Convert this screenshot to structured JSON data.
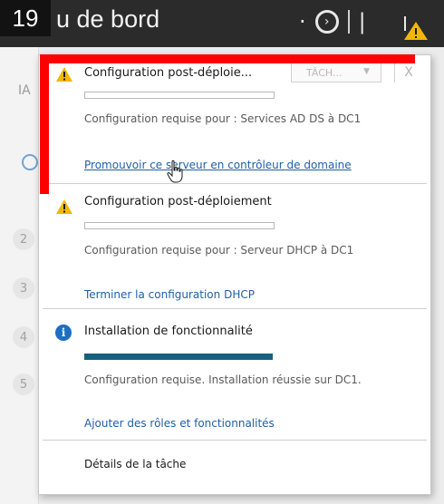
{
  "step_badge": "19",
  "header": {
    "title_fragment": "u de bord"
  },
  "panel": {
    "notifications": [
      {
        "icon": "warning-icon",
        "title": "Configuration post-déploie...",
        "progress": 0,
        "task_dropdown": "TÂCH...",
        "close": "X",
        "description": "Configuration requise pour : Services AD DS à DC1",
        "link": "Promouvoir ce serveur en contrôleur de domaine"
      },
      {
        "icon": "warning-icon",
        "title": "Configuration post-déploiement",
        "progress": 0,
        "description": "Configuration requise pour : Serveur DHCP à DC1",
        "link": "Terminer la configuration DHCP"
      },
      {
        "icon": "info-icon",
        "title": "Installation de fonctionnalité",
        "progress": 1,
        "description": "Configuration requise. Installation réussie sur DC1.",
        "link": "Ajouter des rôles et fonctionnalités"
      }
    ],
    "details_link": "Détails de la tâche"
  },
  "left_fragments": [
    "IA",
    "2",
    "3",
    "4",
    "5"
  ],
  "colors": {
    "highlight": "#ff0000",
    "link": "#1f5fa8",
    "progress_fill": "#17617f",
    "info": "#1d6fc1",
    "warning": "#f2b705"
  }
}
